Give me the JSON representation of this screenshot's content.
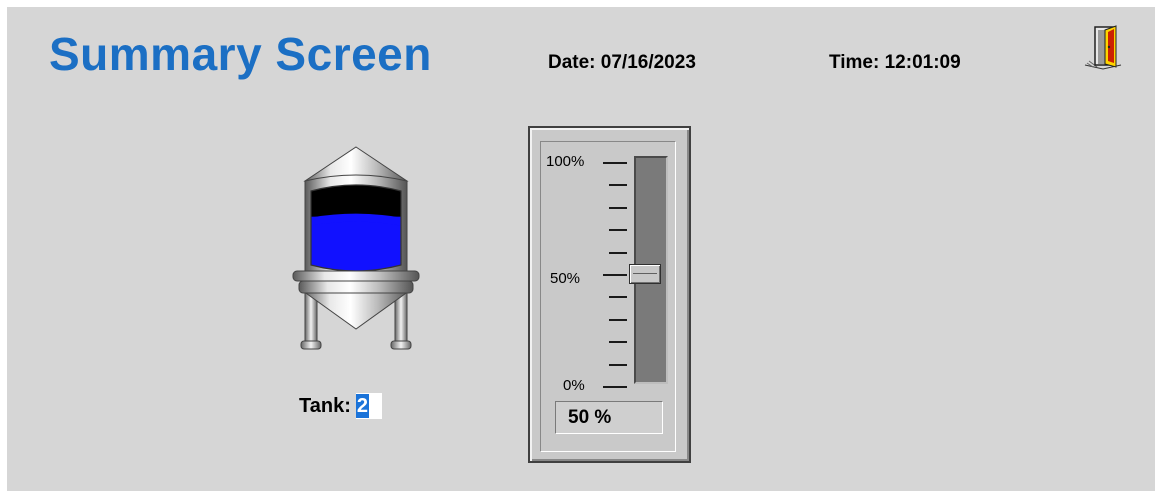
{
  "header": {
    "title": "Summary Screen",
    "date_text": "Date: 07/16/2023",
    "time_text": "Time: 12:01:09",
    "exit_icon": "door-exit-icon"
  },
  "tank": {
    "label": "Tank:",
    "number": "2",
    "level_fraction": 0.64,
    "liquid_color": "#1111ff",
    "headspace_color": "#000000",
    "icon": "tank-icon"
  },
  "slider": {
    "scale_top": "100%",
    "scale_mid": "50%",
    "scale_bottom": "0%",
    "value_fraction": 0.5,
    "value_text": "50 %"
  }
}
